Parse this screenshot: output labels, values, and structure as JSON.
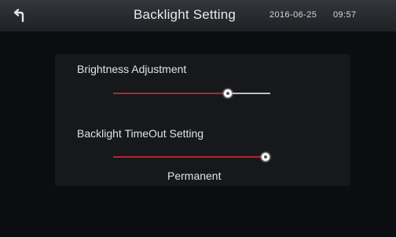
{
  "header": {
    "title": "Backlight Setting",
    "date": "2016-06-25",
    "time": "09:57",
    "back_icon": "back-arrow-icon"
  },
  "brightness": {
    "label": "Brightness Adjustment",
    "level": 0.73
  },
  "timeout": {
    "label": "Backlight TimeOut Setting",
    "level": 1.0,
    "value": "Permanent"
  },
  "colors": {
    "accent": "#b3262c",
    "track": "#bdbdbd",
    "background": "#0c0d10",
    "panel": "#16181c"
  }
}
